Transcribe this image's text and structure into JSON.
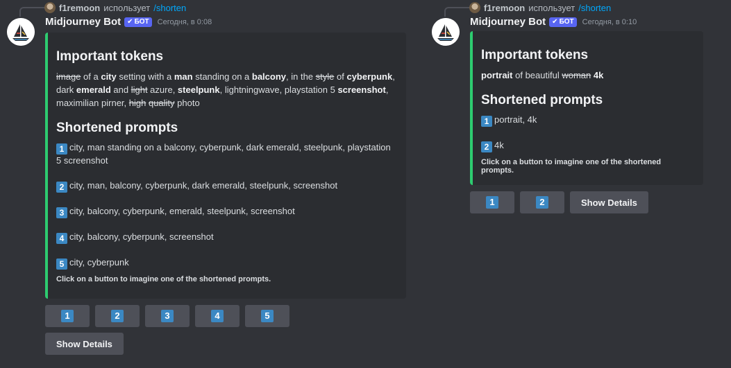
{
  "messages": [
    {
      "reply": {
        "user": "f1remoon",
        "text": "использует",
        "command": "/shorten"
      },
      "bot": {
        "name": "Midjourney Bot",
        "badge": "БОТ",
        "timestamp": "Сегодня, в 0:08"
      },
      "embed": {
        "heading_tokens": "Important tokens",
        "tokens": [
          {
            "t": "image",
            "s": "strike"
          },
          {
            "t": " of a ",
            "s": ""
          },
          {
            "t": "city",
            "s": "bold"
          },
          {
            "t": " setting with a ",
            "s": ""
          },
          {
            "t": "man",
            "s": "bold"
          },
          {
            "t": " standing on a ",
            "s": ""
          },
          {
            "t": "balcony",
            "s": "bold"
          },
          {
            "t": ", in the ",
            "s": ""
          },
          {
            "t": "style",
            "s": "strike"
          },
          {
            "t": " of ",
            "s": ""
          },
          {
            "t": "cyberpunk",
            "s": "bold"
          },
          {
            "t": ", dark ",
            "s": ""
          },
          {
            "t": "emerald",
            "s": "bold"
          },
          {
            "t": " and ",
            "s": ""
          },
          {
            "t": "light",
            "s": "strike"
          },
          {
            "t": " azure, ",
            "s": ""
          },
          {
            "t": "steelpunk",
            "s": "bold"
          },
          {
            "t": ", lightningwave, playstation 5 ",
            "s": ""
          },
          {
            "t": "screenshot",
            "s": "bold"
          },
          {
            "t": ", maximilian pirner, ",
            "s": ""
          },
          {
            "t": "high",
            "s": "strike"
          },
          {
            "t": " ",
            "s": ""
          },
          {
            "t": "quality",
            "s": "strike"
          },
          {
            "t": " photo",
            "s": ""
          }
        ],
        "heading_prompts": "Shortened prompts",
        "prompts": [
          {
            "num": "1",
            "text": "city, man standing on a balcony, cyberpunk, dark emerald, steelpunk, playstation 5 screenshot"
          },
          {
            "num": "2",
            "text": "city, man, balcony, cyberpunk, dark emerald, steelpunk, screenshot"
          },
          {
            "num": "3",
            "text": "city, balcony, cyberpunk, emerald, steelpunk, screenshot"
          },
          {
            "num": "4",
            "text": "city, balcony, cyberpunk, screenshot"
          },
          {
            "num": "5",
            "text": "city, cyberpunk"
          }
        ],
        "footer": "Click on a button to imagine one of the shortened prompts."
      },
      "buttons": [
        "1",
        "2",
        "3",
        "4",
        "5"
      ],
      "details_button": "Show Details"
    },
    {
      "reply": {
        "user": "f1remoon",
        "text": "использует",
        "command": "/shorten"
      },
      "bot": {
        "name": "Midjourney Bot",
        "badge": "БОТ",
        "timestamp": "Сегодня, в 0:10"
      },
      "embed": {
        "heading_tokens": "Important tokens",
        "tokens": [
          {
            "t": "portrait",
            "s": "bold"
          },
          {
            "t": " of beautiful ",
            "s": ""
          },
          {
            "t": "woman",
            "s": "strike"
          },
          {
            "t": " ",
            "s": ""
          },
          {
            "t": "4k",
            "s": "bold"
          }
        ],
        "heading_prompts": "Shortened prompts",
        "prompts": [
          {
            "num": "1",
            "text": "portrait, 4k"
          },
          {
            "num": "2",
            "text": "4k"
          }
        ],
        "footer": "Click on a button to imagine one of the shortened prompts."
      },
      "buttons": [
        "1",
        "2"
      ],
      "details_button": "Show Details"
    }
  ],
  "colors": {
    "embed_accent": "#2dcc70",
    "keycap": "#3b88c3",
    "bot_badge": "#5865f2",
    "command_link": "#00a8fc"
  }
}
